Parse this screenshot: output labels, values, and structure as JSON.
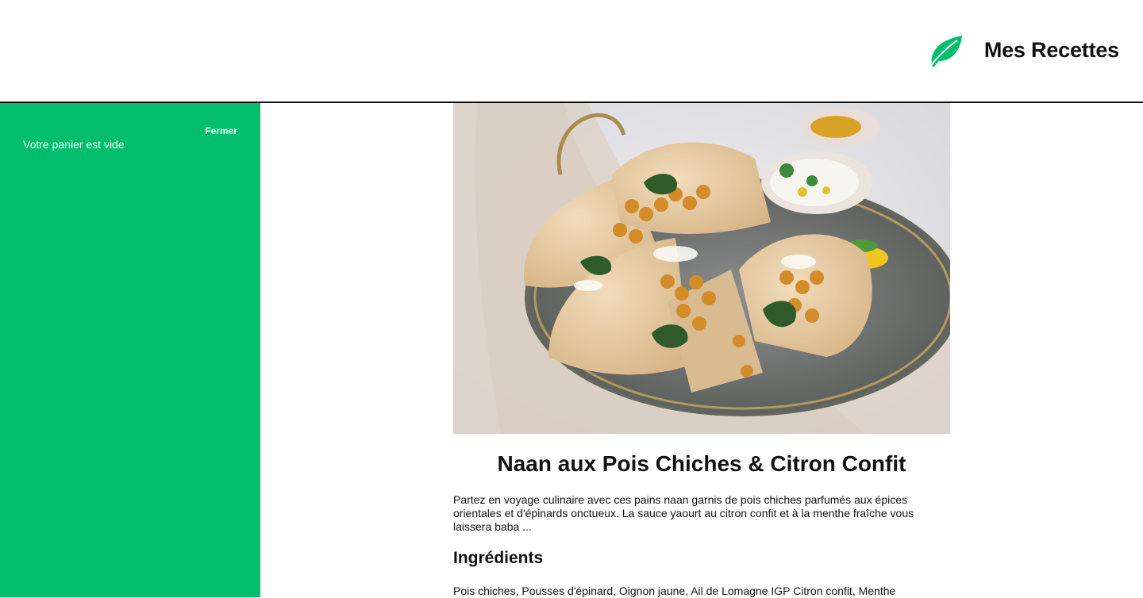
{
  "header": {
    "brand_title": "Mes Recettes",
    "logo_icon": "leaf-icon",
    "accent_color": "#00bd6b"
  },
  "cart": {
    "close_label": "Fermer",
    "empty_message": "Votre panier est vide",
    "background_color": "#00bd6b"
  },
  "recipe": {
    "image_subject": "naan-pois-chiches-photo",
    "title": "Naan aux Pois Chiches & Citron Confit",
    "description": "Partez en voyage culinaire avec ces pains naan garnis de pois chiches parfumés aux épices orientales et d'épinards onctueux. La sauce yaourt au citron confit et à la menthe fraîche vous laissera baba ...",
    "ingredients_heading": "Ingrédients",
    "ingredients_text": "Pois chiches, Pousses d'épinard, Oignon jaune, Ail de Lomagne IGP Citron confit, Menthe"
  }
}
